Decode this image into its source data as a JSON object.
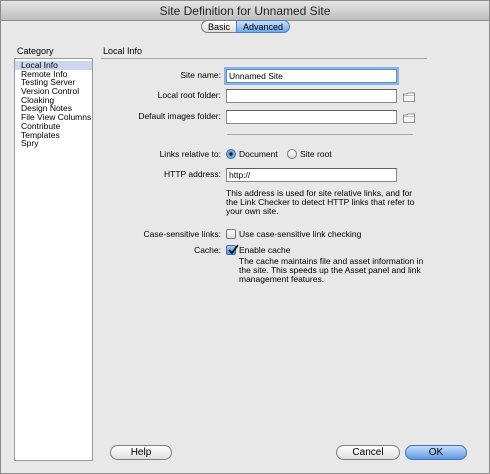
{
  "window": {
    "title": "Site Definition for Unnamed Site"
  },
  "tabs": [
    {
      "label": "Basic",
      "active": false
    },
    {
      "label": "Advanced",
      "active": true
    }
  ],
  "category": {
    "label": "Category",
    "items": [
      {
        "label": "Local Info",
        "selected": true
      },
      {
        "label": "Remote Info"
      },
      {
        "label": "Testing Server"
      },
      {
        "label": "Version Control"
      },
      {
        "label": "Cloaking"
      },
      {
        "label": "Design Notes"
      },
      {
        "label": "File View Columns"
      },
      {
        "label": "Contribute"
      },
      {
        "label": "Templates"
      },
      {
        "label": "Spry"
      }
    ]
  },
  "local_info": {
    "title": "Local Info",
    "site_name_label": "Site name:",
    "site_name_value": "Unnamed Site",
    "local_root_label": "Local root folder:",
    "local_root_value": "",
    "default_images_label": "Default images folder:",
    "default_images_value": "",
    "links_label": "Links relative to:",
    "links_options": [
      {
        "label": "Document",
        "selected": true
      },
      {
        "label": "Site root",
        "selected": false
      }
    ],
    "http_label": "HTTP address:",
    "http_value": "http://",
    "http_help": [
      "This address is used for site relative links, and for",
      "the Link Checker to detect HTTP links that refer to",
      "your own site."
    ],
    "case_label": "Case-sensitive links:",
    "case_checkbox_label": "Use case-sensitive link checking",
    "case_checked": false,
    "cache_label": "Cache:",
    "cache_checkbox_label": "Enable cache",
    "cache_checked": true,
    "cache_help": [
      "The cache maintains file and asset information in",
      "the site.  This speeds up the Asset panel and link",
      "management features."
    ]
  },
  "buttons": {
    "help": "Help",
    "cancel": "Cancel",
    "ok": "OK"
  },
  "colors": {
    "accent": "#5e9be6",
    "selection": "#c9d8ee"
  }
}
